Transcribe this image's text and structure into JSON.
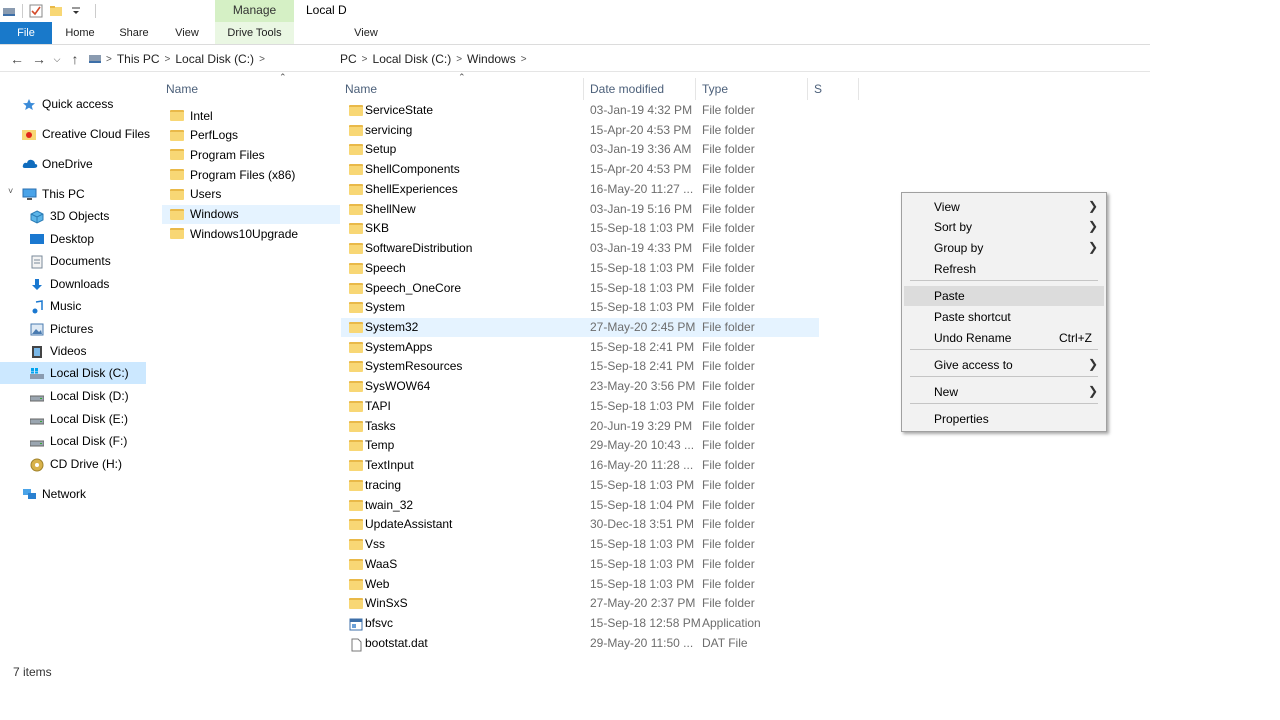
{
  "window": {
    "manage_label": "Manage",
    "title": "Local D",
    "drive_tools_label": "Drive Tools"
  },
  "ribbon": {
    "tabs": [
      "File",
      "Home",
      "Share",
      "View"
    ],
    "view_label": "View"
  },
  "left_breadcrumb": [
    "This PC",
    "Local Disk (C:)"
  ],
  "right_breadcrumb": [
    "PC",
    "Local Disk (C:)",
    "Windows"
  ],
  "left_pane": {
    "header": "Name",
    "items": [
      "Intel",
      "PerfLogs",
      "Program Files",
      "Program Files (x86)",
      "Users",
      "Windows",
      "Windows10Upgrade"
    ],
    "selected": "Windows"
  },
  "sidebar": {
    "items": [
      {
        "label": "Quick access",
        "icon": "star-icon"
      },
      {
        "label": "Creative Cloud Files",
        "icon": "creative-cloud-folder-icon"
      },
      {
        "label": "OneDrive",
        "icon": "cloud-icon"
      },
      {
        "label": "This PC",
        "icon": "computer-icon"
      },
      {
        "label": "3D Objects",
        "icon": "cube-icon"
      },
      {
        "label": "Desktop",
        "icon": "desktop-icon"
      },
      {
        "label": "Documents",
        "icon": "document-icon"
      },
      {
        "label": "Downloads",
        "icon": "download-arrow-icon"
      },
      {
        "label": "Music",
        "icon": "music-note-icon"
      },
      {
        "label": "Pictures",
        "icon": "picture-icon"
      },
      {
        "label": "Videos",
        "icon": "film-icon"
      },
      {
        "label": "Local Disk (C:)",
        "icon": "windows-drive-icon"
      },
      {
        "label": "Local Disk (D:)",
        "icon": "drive-icon"
      },
      {
        "label": "Local Disk (E:)",
        "icon": "drive-icon"
      },
      {
        "label": "Local Disk (F:)",
        "icon": "drive-icon"
      },
      {
        "label": "CD Drive (H:)",
        "icon": "cd-icon"
      },
      {
        "label": "Network",
        "icon": "network-icon"
      }
    ]
  },
  "columns": {
    "name": "Name",
    "date": "Date modified",
    "type": "Type",
    "size": "S"
  },
  "files": [
    {
      "name": "ServiceState",
      "date": "03-Jan-19 4:32 PM",
      "type": "File folder",
      "kind": "folder"
    },
    {
      "name": "servicing",
      "date": "15-Apr-20 4:53 PM",
      "type": "File folder",
      "kind": "folder"
    },
    {
      "name": "Setup",
      "date": "03-Jan-19 3:36 AM",
      "type": "File folder",
      "kind": "folder"
    },
    {
      "name": "ShellComponents",
      "date": "15-Apr-20 4:53 PM",
      "type": "File folder",
      "kind": "folder"
    },
    {
      "name": "ShellExperiences",
      "date": "16-May-20 11:27 ...",
      "type": "File folder",
      "kind": "folder"
    },
    {
      "name": "ShellNew",
      "date": "03-Jan-19 5:16 PM",
      "type": "File folder",
      "kind": "folder"
    },
    {
      "name": "SKB",
      "date": "15-Sep-18 1:03 PM",
      "type": "File folder",
      "kind": "folder"
    },
    {
      "name": "SoftwareDistribution",
      "date": "03-Jan-19 4:33 PM",
      "type": "File folder",
      "kind": "folder"
    },
    {
      "name": "Speech",
      "date": "15-Sep-18 1:03 PM",
      "type": "File folder",
      "kind": "folder"
    },
    {
      "name": "Speech_OneCore",
      "date": "15-Sep-18 1:03 PM",
      "type": "File folder",
      "kind": "folder"
    },
    {
      "name": "System",
      "date": "15-Sep-18 1:03 PM",
      "type": "File folder",
      "kind": "folder"
    },
    {
      "name": "System32",
      "date": "27-May-20 2:45 PM",
      "type": "File folder",
      "kind": "folder"
    },
    {
      "name": "SystemApps",
      "date": "15-Sep-18 2:41 PM",
      "type": "File folder",
      "kind": "folder"
    },
    {
      "name": "SystemResources",
      "date": "15-Sep-18 2:41 PM",
      "type": "File folder",
      "kind": "folder"
    },
    {
      "name": "SysWOW64",
      "date": "23-May-20 3:56 PM",
      "type": "File folder",
      "kind": "folder"
    },
    {
      "name": "TAPI",
      "date": "15-Sep-18 1:03 PM",
      "type": "File folder",
      "kind": "folder"
    },
    {
      "name": "Tasks",
      "date": "20-Jun-19 3:29 PM",
      "type": "File folder",
      "kind": "folder"
    },
    {
      "name": "Temp",
      "date": "29-May-20 10:43 ...",
      "type": "File folder",
      "kind": "folder"
    },
    {
      "name": "TextInput",
      "date": "16-May-20 11:28 ...",
      "type": "File folder",
      "kind": "folder"
    },
    {
      "name": "tracing",
      "date": "15-Sep-18 1:03 PM",
      "type": "File folder",
      "kind": "folder"
    },
    {
      "name": "twain_32",
      "date": "15-Sep-18 1:04 PM",
      "type": "File folder",
      "kind": "folder"
    },
    {
      "name": "UpdateAssistant",
      "date": "30-Dec-18 3:51 PM",
      "type": "File folder",
      "kind": "folder"
    },
    {
      "name": "Vss",
      "date": "15-Sep-18 1:03 PM",
      "type": "File folder",
      "kind": "folder"
    },
    {
      "name": "WaaS",
      "date": "15-Sep-18 1:03 PM",
      "type": "File folder",
      "kind": "folder"
    },
    {
      "name": "Web",
      "date": "15-Sep-18 1:03 PM",
      "type": "File folder",
      "kind": "folder"
    },
    {
      "name": "WinSxS",
      "date": "27-May-20 2:37 PM",
      "type": "File folder",
      "kind": "folder"
    },
    {
      "name": "bfsvc",
      "date": "15-Sep-18 12:58 PM",
      "type": "Application",
      "kind": "app"
    },
    {
      "name": "bootstat.dat",
      "date": "29-May-20 11:50 ...",
      "type": "DAT File",
      "kind": "file"
    }
  ],
  "selected_file": "System32",
  "context_menu": {
    "items": [
      {
        "label": "View",
        "submenu": true
      },
      {
        "label": "Sort by",
        "submenu": true
      },
      {
        "label": "Group by",
        "submenu": true
      },
      {
        "label": "Refresh"
      },
      {
        "label": "Paste",
        "highlighted": true
      },
      {
        "label": "Paste shortcut"
      },
      {
        "label": "Undo Rename",
        "shortcut": "Ctrl+Z"
      },
      {
        "label": "Give access to",
        "submenu": true
      },
      {
        "label": "New",
        "submenu": true
      },
      {
        "label": "Properties"
      }
    ]
  },
  "status": {
    "item_count": "7 items"
  },
  "colors": {
    "file_tab": "#1979ca",
    "selection": "#cce8ff",
    "hover_row": "#e5f3ff",
    "manage_tab": "#d5f0c5"
  }
}
